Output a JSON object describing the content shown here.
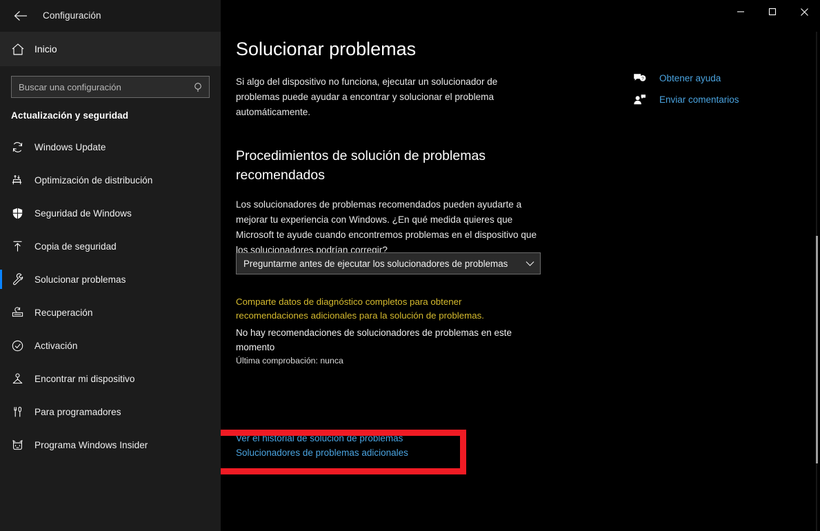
{
  "window": {
    "title": "Configuración",
    "back_icon": "back-arrow-icon",
    "minimize_label": "—",
    "maximize_label": "□",
    "close_label": "✕"
  },
  "sidebar": {
    "home": {
      "label": "Inicio",
      "icon": "home-icon"
    },
    "search": {
      "placeholder": "Buscar una configuración",
      "value": "",
      "icon": "search-icon"
    },
    "group_title": "Actualización y seguridad",
    "items": [
      {
        "label": "Windows Update",
        "icon": "refresh-icon",
        "selected": false
      },
      {
        "label": "Optimización de distribución",
        "icon": "delivery-optimization-icon",
        "selected": false
      },
      {
        "label": "Seguridad de Windows",
        "icon": "shield-icon",
        "selected": false
      },
      {
        "label": "Copia de seguridad",
        "icon": "backup-upload-icon",
        "selected": false
      },
      {
        "label": "Solucionar problemas",
        "icon": "wrench-icon",
        "selected": true
      },
      {
        "label": "Recuperación",
        "icon": "recovery-icon",
        "selected": false
      },
      {
        "label": "Activación",
        "icon": "check-circle-icon",
        "selected": false
      },
      {
        "label": "Encontrar mi dispositivo",
        "icon": "find-device-icon",
        "selected": false
      },
      {
        "label": "Para programadores",
        "icon": "developer-tools-icon",
        "selected": false
      },
      {
        "label": "Programa Windows Insider",
        "icon": "insider-cat-icon",
        "selected": false
      }
    ]
  },
  "main": {
    "page_title": "Solucionar problemas",
    "intro": "Si algo del dispositivo no funciona, ejecutar un solucionador de problemas puede ayudar a encontrar y solucionar el problema automáticamente.",
    "section_heading": "Procedimientos de solución de problemas recomendados",
    "section_paragraph": "Los solucionadores de problemas recomendados pueden ayudarte a mejorar tu experiencia con Windows. ¿En qué medida quieres que Microsoft te ayude cuando encontremos problemas en el dispositivo que los solucionadores podrían corregir?",
    "dropdown": {
      "value": "Preguntarme antes de ejecutar los solucionadores de problemas",
      "icon": "chevron-down-icon"
    },
    "warning_text": "Comparte datos de diagnóstico completos para obtener recomendaciones adicionales para la solución de problemas.",
    "no_recommendations": "No hay recomendaciones de solucionadores de problemas en este momento",
    "last_check": "Última comprobación: nunca",
    "history_link": "Ver el historial de solución de problemas",
    "additional_link": "Solucionadores de problemas adicionales"
  },
  "help": {
    "items": [
      {
        "label": "Obtener ayuda",
        "icon": "help-chat-icon"
      },
      {
        "label": "Enviar comentarios",
        "icon": "feedback-person-icon"
      }
    ]
  },
  "colors": {
    "accent_blue": "#0a84ff",
    "link_blue": "#4aa3df",
    "warning_yellow": "#d6bb2e",
    "highlight_red": "#f01b24",
    "sidebar_bg": "#1c1c1c",
    "main_bg": "#000000"
  }
}
